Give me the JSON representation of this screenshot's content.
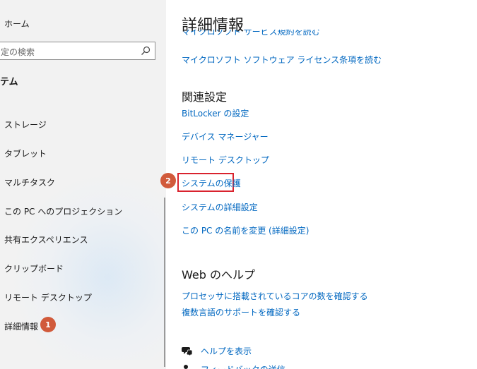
{
  "sidebar": {
    "home_label": "ホーム",
    "search_placeholder": "定の検索",
    "group_label": "テム",
    "items": [
      {
        "label": "ストレージ"
      },
      {
        "label": "タブレット"
      },
      {
        "label": "マルチタスク"
      },
      {
        "label": "この PC へのプロジェクション"
      },
      {
        "label": "共有エクスペリエンス"
      },
      {
        "label": "クリップボード"
      },
      {
        "label": "リモート デスクトップ"
      },
      {
        "label": "詳細情報"
      }
    ],
    "step_badge": "1"
  },
  "main": {
    "title": "詳細情報",
    "cut_link": "マイクロソフト サービス規約を読む",
    "license_link": "マイクロソフト ソフトウェア ライセンス条項を読む",
    "related": {
      "title": "関連設定",
      "links": [
        "BitLocker の設定",
        "デバイス マネージャー",
        "リモート デスクトップ",
        "システムの保護",
        "システムの詳細設定",
        "この PC の名前を変更 (詳細設定)"
      ],
      "step_badge": "2"
    },
    "web_help": {
      "title": "Web のヘルプ",
      "links": [
        "プロセッサに搭載されているコアの数を確認する",
        "複数言語のサポートを確認する"
      ]
    },
    "support": {
      "get_help": "ヘルプを表示",
      "feedback": "フィードバックの送信"
    }
  },
  "colors": {
    "link": "#0067c0",
    "badge": "#d15a3b",
    "highlight_border": "#d9232e",
    "sidebar_bg": "#f2f2f2"
  }
}
